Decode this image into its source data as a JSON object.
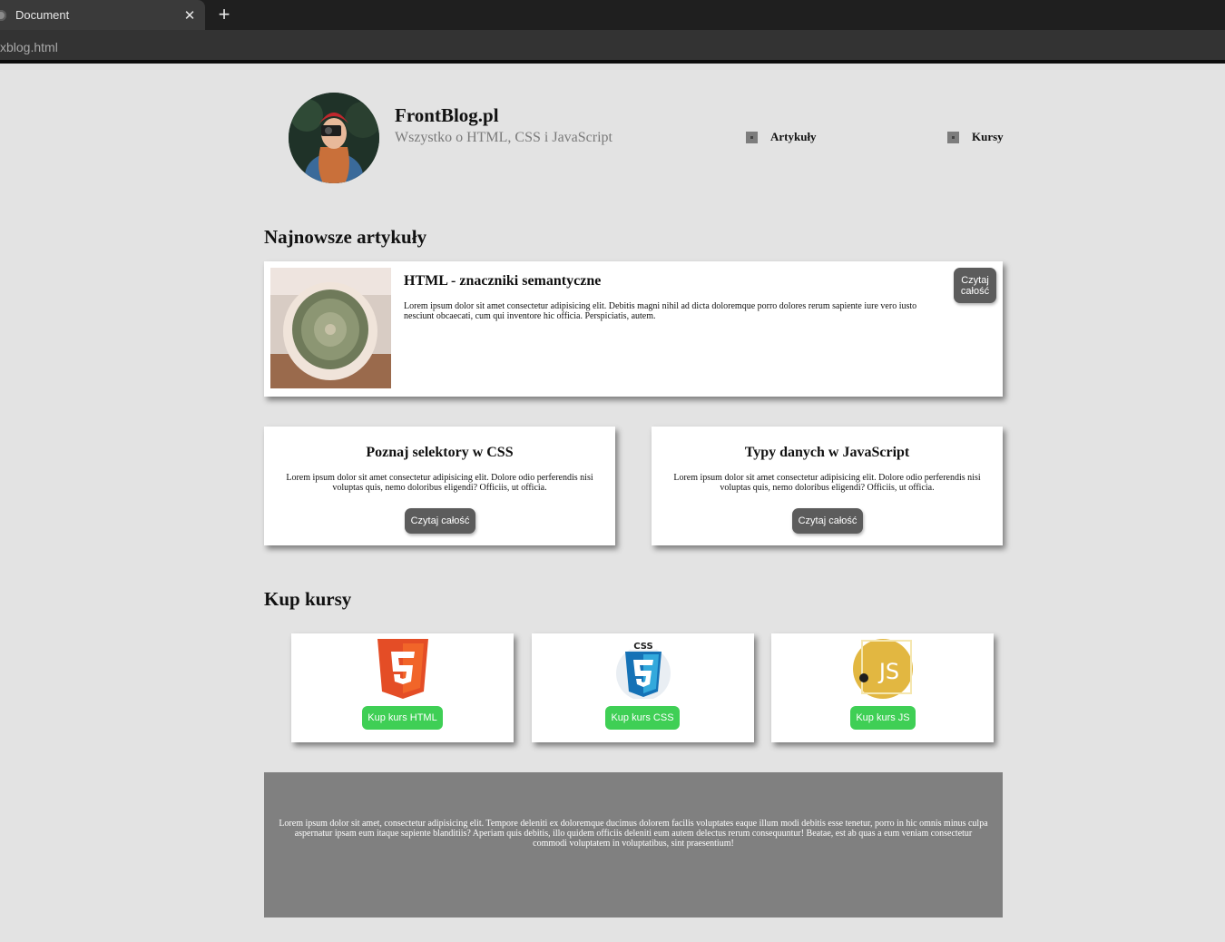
{
  "browser": {
    "tab_title": "Document",
    "address": "xblog.html"
  },
  "header": {
    "title": "FrontBlog.pl",
    "subtitle": "Wszystko o HTML, CSS i JavaScript",
    "nav": [
      "Artykuły",
      "Kursy"
    ]
  },
  "articles": {
    "heading": "Najnowsze artykuły",
    "featured": {
      "title": "HTML - znaczniki semantyczne",
      "text": "Lorem ipsum dolor sit amet consectetur adipisicing elit. Debitis magni nihil ad dicta doloremque porro dolores rerum sapiente iure vero iusto nesciunt obcaecati, cum qui inventore hic officia. Perspiciatis, autem.",
      "button": "Czytaj całość"
    },
    "cards": [
      {
        "title": "Poznaj selektory w CSS",
        "text": "Lorem ipsum dolor sit amet consectetur adipisicing elit. Dolore odio perferendis nisi voluptas quis, nemo doloribus eligendi? Officiis, ut officia.",
        "button": "Czytaj całość"
      },
      {
        "title": "Typy danych w JavaScript",
        "text": "Lorem ipsum dolor sit amet consectetur adipisicing elit. Dolore odio perferendis nisi voluptas quis, nemo doloribus eligendi? Officiis, ut officia.",
        "button": "Czytaj całość"
      }
    ]
  },
  "courses": {
    "heading": "Kup kursy",
    "items": [
      {
        "button": "Kup kurs HTML",
        "logo_text": "5",
        "icon": "html5-logo-icon"
      },
      {
        "button": "Kup kurs CSS",
        "logo_text": "CSS",
        "icon": "css3-logo-icon"
      },
      {
        "button": "Kup kurs JS",
        "logo_text": "JS",
        "icon": "js-logo-icon"
      }
    ]
  },
  "footer": {
    "text": "Lorem ipsum dolor sit amet, consectetur adipisicing elit. Tempore deleniti ex doloremque ducimus dolorem facilis voluptates eaque illum modi debitis esse tenetur, porro in hic omnis minus culpa aspernatur ipsam eum itaque sapiente blanditiis? Aperiam quis debitis, illo quidem officiis deleniti eum autem delectus rerum consequuntur! Beatae, est ab quas a eum veniam consectetur commodi voluptatem in voluptatibus, sint praesentium!"
  },
  "colors": {
    "page_bg": "#e3e3e3",
    "dark_button": "#5c5c5c",
    "green_button": "#3fcf55",
    "footer_bg": "#808080",
    "html5_orange": "#e44d26",
    "css3_blue": "#1572b6",
    "js_yellow": "#e2b741"
  }
}
